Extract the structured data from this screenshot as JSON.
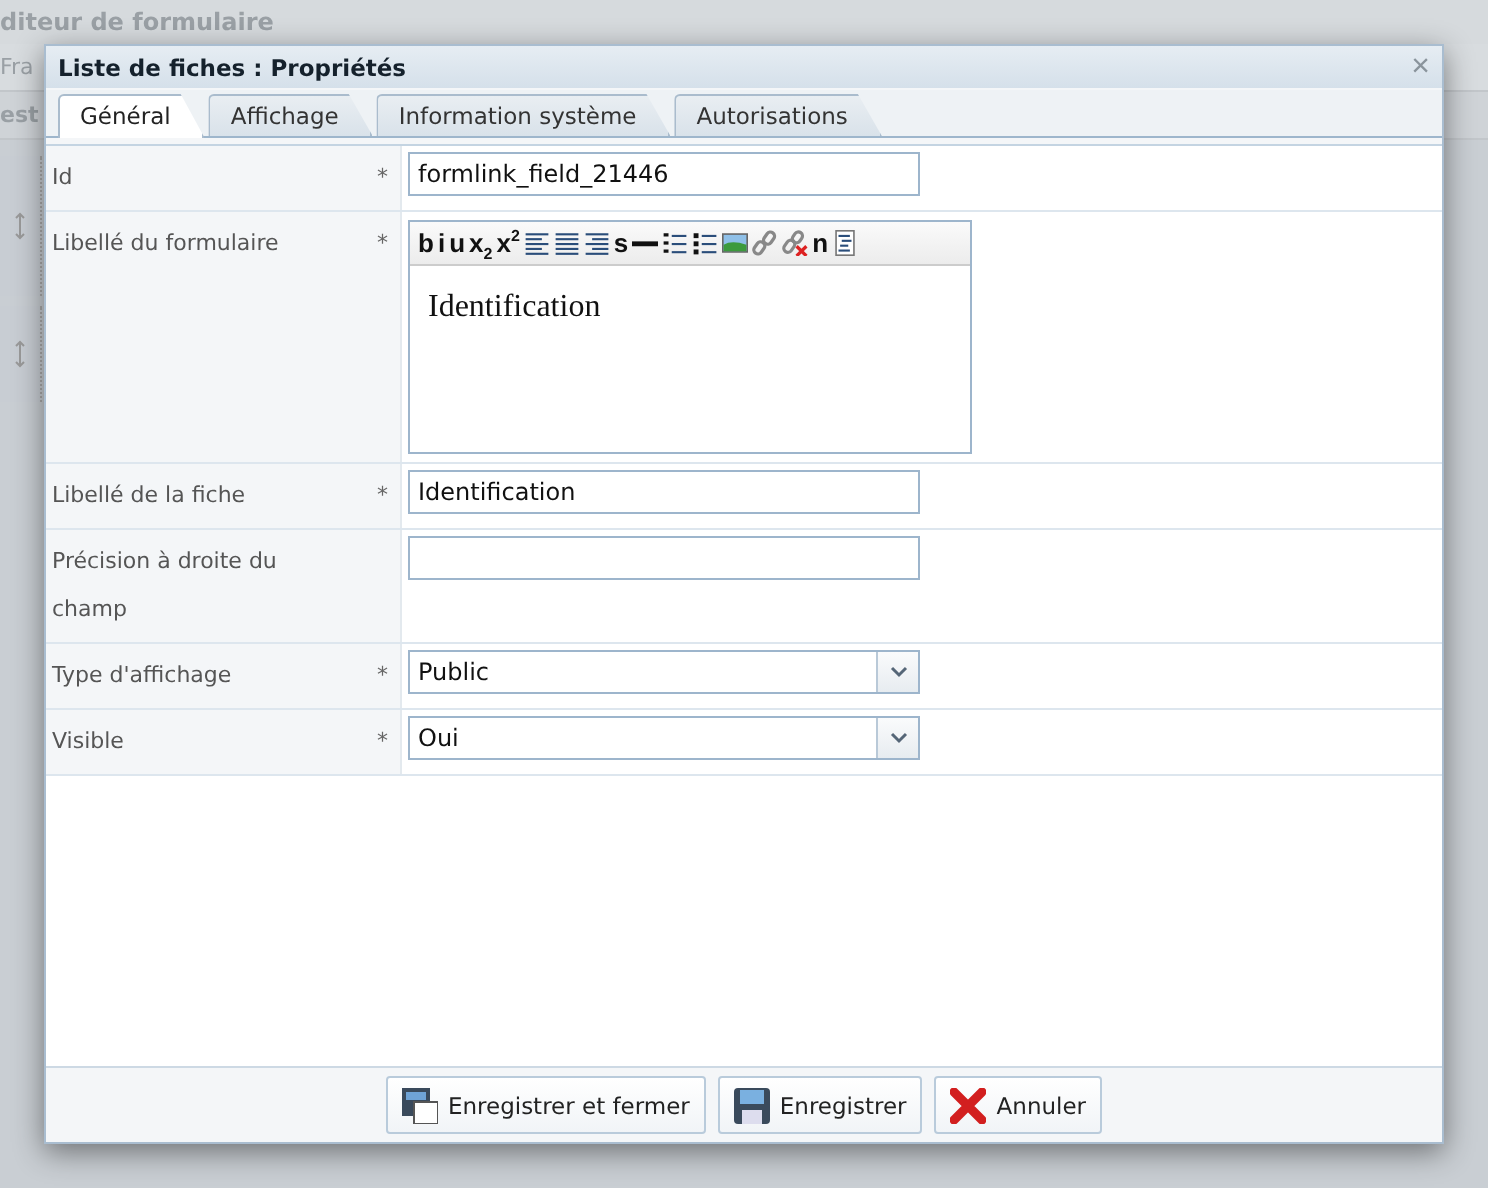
{
  "background": {
    "title": "diteur de formulaire",
    "row_1": "Fra",
    "row_2": "est"
  },
  "dialog": {
    "title": "Liste de fiches : Propriétés",
    "close": "×",
    "tabs": [
      {
        "label": "Général",
        "selected": true
      },
      {
        "label": "Affichage",
        "selected": false
      },
      {
        "label": "Information système",
        "selected": false
      },
      {
        "label": "Autorisations",
        "selected": false
      }
    ],
    "fields": [
      {
        "label": "Id",
        "marker": "*",
        "kind": "input",
        "value": "formlink_field_21446"
      },
      {
        "label": "Libellé du formulaire",
        "marker": "*",
        "kind": "editor",
        "value": "Identification"
      },
      {
        "label": "Libellé de la fiche",
        "marker": "*",
        "kind": "input",
        "value": "Identification"
      },
      {
        "label": "Précision à droite du champ",
        "kind": "input"
      },
      {
        "label": "Type d'affichage",
        "marker": "*",
        "kind": "select",
        "value": "Public"
      },
      {
        "label": "Visible",
        "marker": "*",
        "kind": "select",
        "value": "Oui"
      }
    ],
    "editor_toolbar": [
      {
        "kind": "text",
        "label": "b"
      },
      {
        "kind": "text",
        "label": "i"
      },
      {
        "kind": "text",
        "label": "u"
      },
      {
        "kind": "text",
        "label": "x$_{2}$"
      },
      {
        "kind": "text",
        "label": "x$^{2}$"
      },
      {
        "kind": "align-left"
      },
      {
        "kind": "justify"
      },
      {
        "kind": "align-right"
      },
      {
        "kind": "text",
        "label": "s"
      },
      {
        "kind": "rule"
      },
      {
        "kind": "ordered-list"
      },
      {
        "kind": "bullet-list"
      },
      {
        "kind": "image"
      },
      {
        "kind": "link"
      },
      {
        "kind": "unlink"
      },
      {
        "kind": "text",
        "label": "n"
      },
      {
        "kind": "source"
      }
    ],
    "buttons": [
      {
        "label": "Enregistrer et fermer",
        "kind": "save-close"
      },
      {
        "label": "Enregistrer",
        "kind": "save"
      },
      {
        "label": "Annuler",
        "kind": "cancel"
      }
    ]
  }
}
